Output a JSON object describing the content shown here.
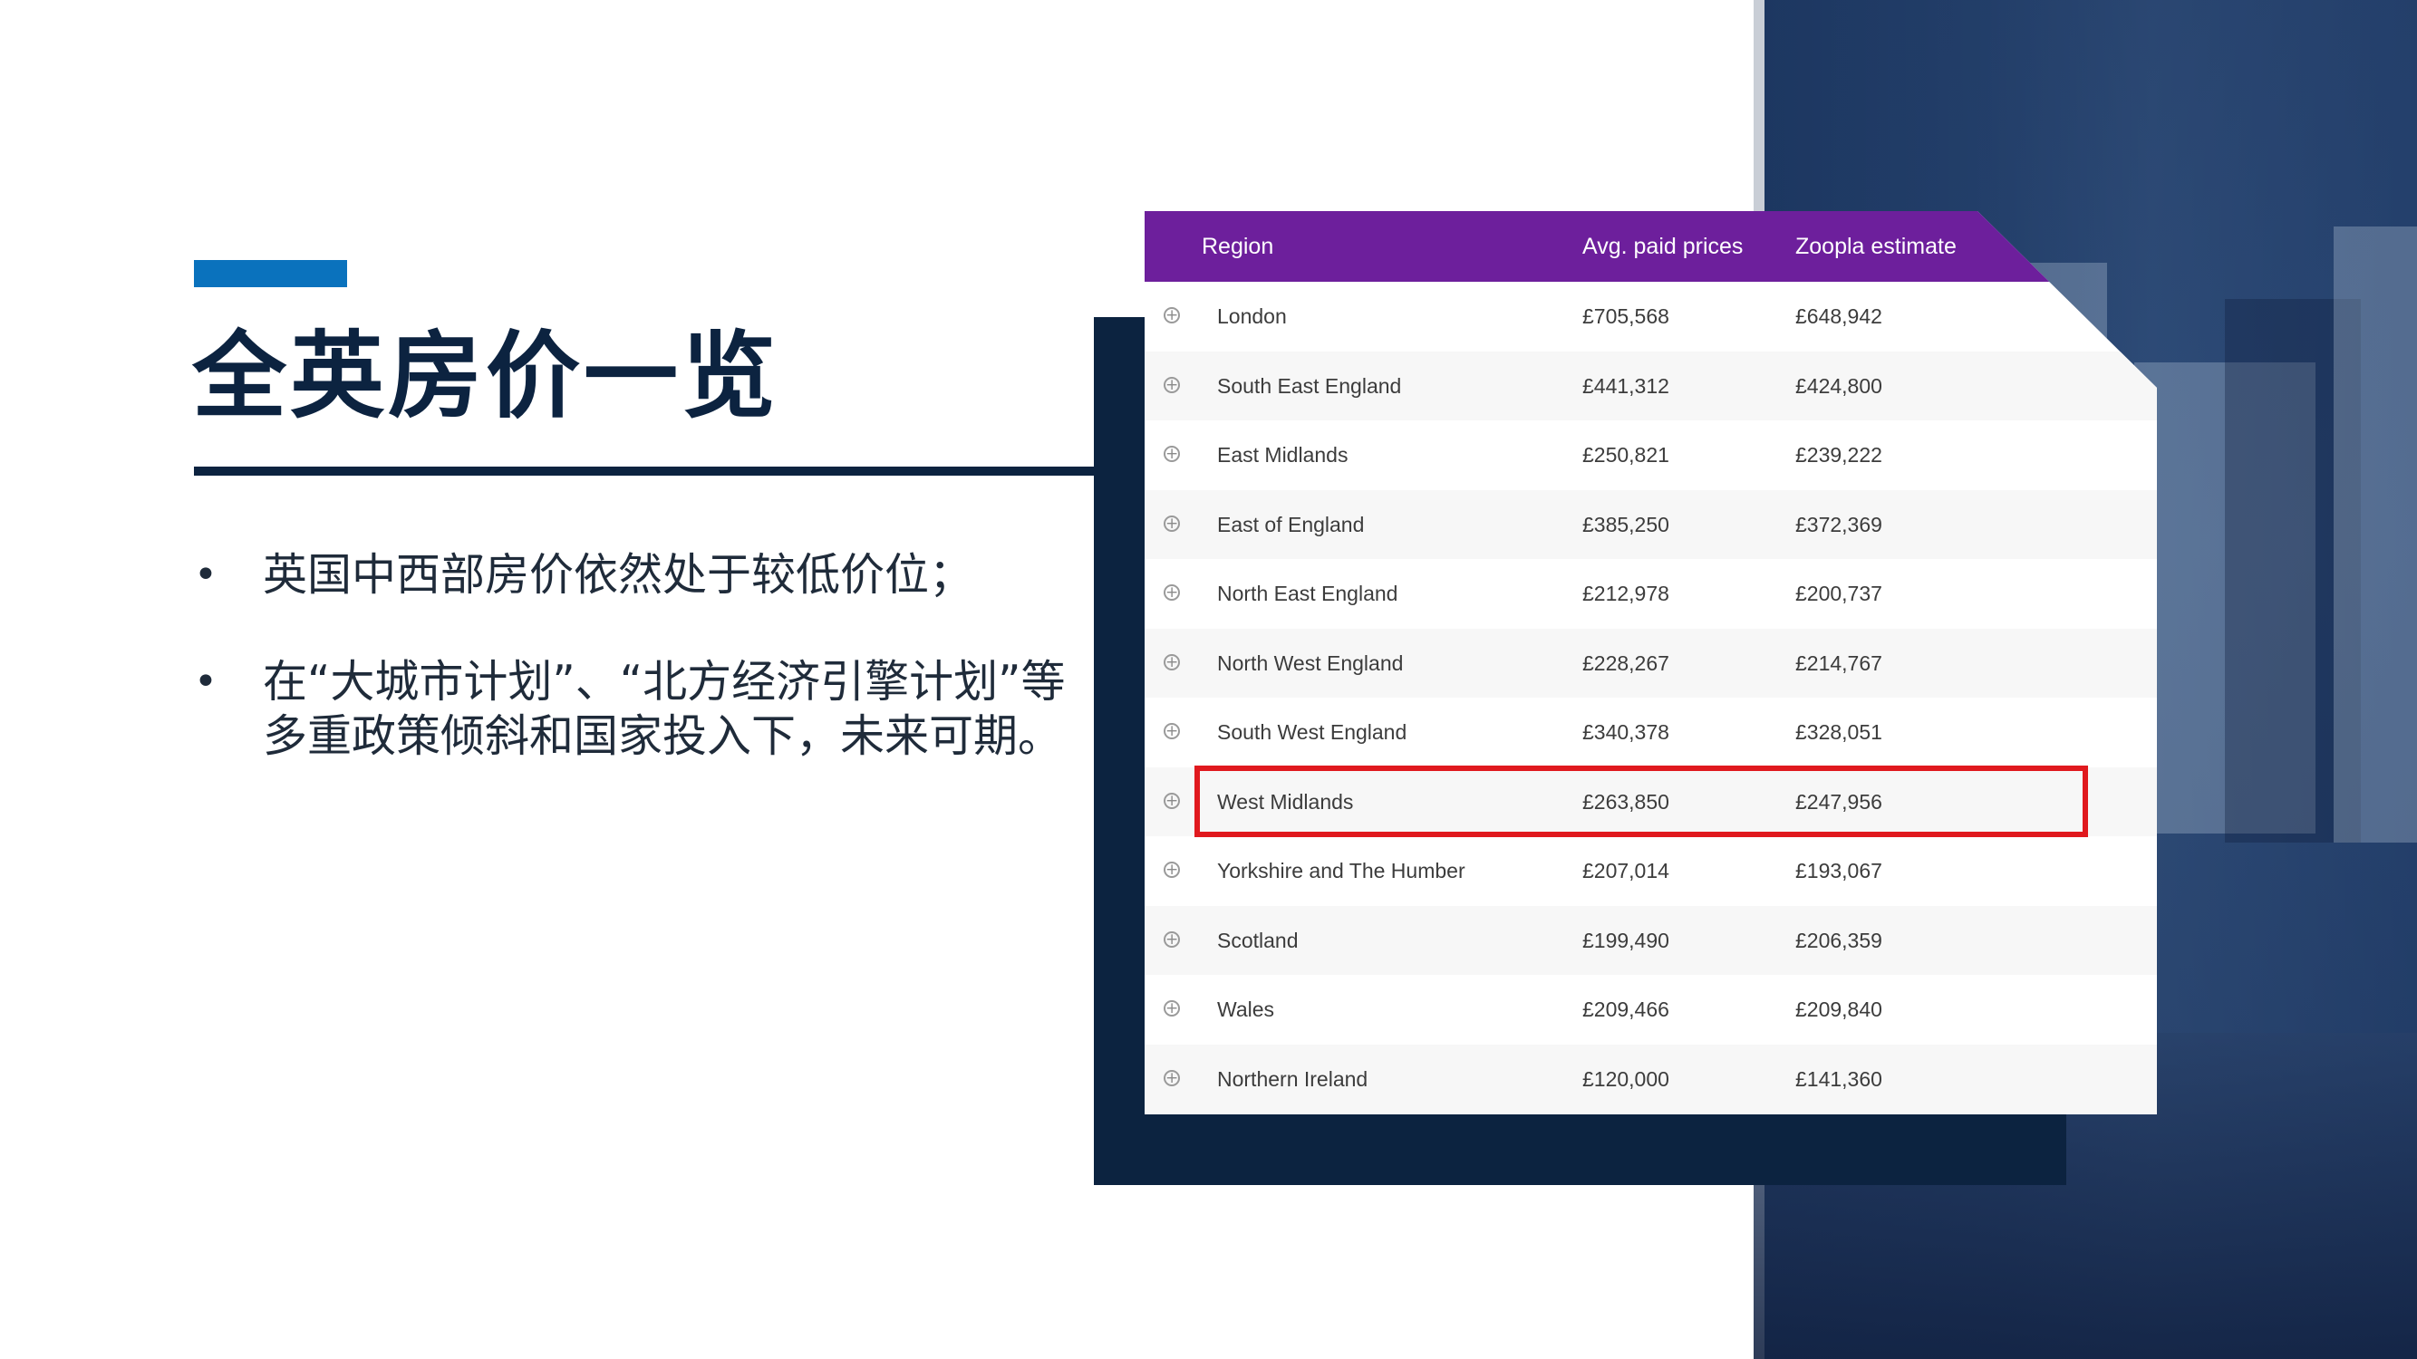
{
  "slide": {
    "title": "全英房价一览",
    "bullets": [
      "英国中西部房价依然处于较低价位；",
      "在“大城市计划”、“北方经济引擎计划”等多重政策倾斜和国家投入下，未来可期。"
    ],
    "bullet_symbol": "•"
  },
  "colors": {
    "navy": "#0c2340",
    "accent_blue": "#0a72bd",
    "table_header": "#6d1f9c",
    "highlight_red": "#e0191e"
  },
  "table": {
    "headers": {
      "region": "Region",
      "avg": "Avg. paid prices",
      "estimate": "Zoopla estimate"
    },
    "expand_icon": "+",
    "rows": [
      {
        "region": "London",
        "avg": "£705,568",
        "estimate": "£648,942"
      },
      {
        "region": "South East England",
        "avg": "£441,312",
        "estimate": "£424,800"
      },
      {
        "region": "East Midlands",
        "avg": "£250,821",
        "estimate": "£239,222"
      },
      {
        "region": "East of England",
        "avg": "£385,250",
        "estimate": "£372,369"
      },
      {
        "region": "North East England",
        "avg": "£212,978",
        "estimate": "£200,737"
      },
      {
        "region": "North West England",
        "avg": "£228,267",
        "estimate": "£214,767"
      },
      {
        "region": "South West England",
        "avg": "£340,378",
        "estimate": "£328,051"
      },
      {
        "region": "West Midlands",
        "avg": "£263,850",
        "estimate": "£247,956"
      },
      {
        "region": "Yorkshire and The Humber",
        "avg": "£207,014",
        "estimate": "£193,067"
      },
      {
        "region": "Scotland",
        "avg": "£199,490",
        "estimate": "£206,359"
      },
      {
        "region": "Wales",
        "avg": "£209,466",
        "estimate": "£209,840"
      },
      {
        "region": "Northern Ireland",
        "avg": "£120,000",
        "estimate": "£141,360"
      }
    ],
    "highlighted_region": "West Midlands"
  }
}
